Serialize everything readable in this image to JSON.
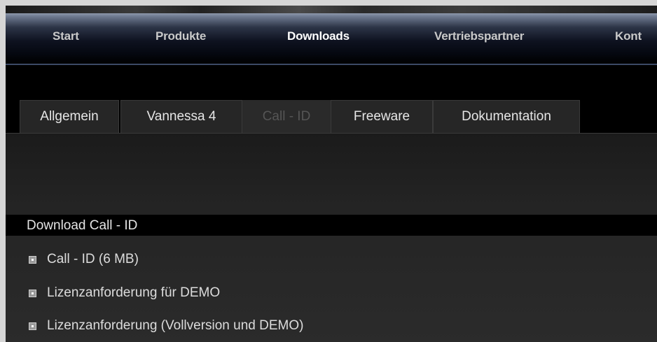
{
  "nav": {
    "items": [
      {
        "label": "Start",
        "active": false
      },
      {
        "label": "Produkte",
        "active": false
      },
      {
        "label": "Downloads",
        "active": true
      },
      {
        "label": "Vertriebspartner",
        "active": false
      },
      {
        "label": "Kont",
        "active": false
      }
    ]
  },
  "tabs": [
    {
      "label": "Allgemein",
      "active": false
    },
    {
      "label": "Vannessa 4",
      "active": false
    },
    {
      "label": "Call - ID",
      "active": true
    },
    {
      "label": "Freeware",
      "active": false
    },
    {
      "label": "Dokumentation",
      "active": false
    }
  ],
  "section": {
    "title": "Download Call - ID",
    "items": [
      {
        "label": "Call - ID (6 MB)"
      },
      {
        "label": "Lizenzanforderung für DEMO"
      },
      {
        "label": "Lizenzanforderung (Vollversion und DEMO)"
      }
    ]
  },
  "icons": {
    "bullet": "square-bullet-icon"
  },
  "colors": {
    "background": "#000000",
    "panel": "#262626",
    "active_tab_text": "#555555",
    "nav_text": "#c9c9c9"
  }
}
